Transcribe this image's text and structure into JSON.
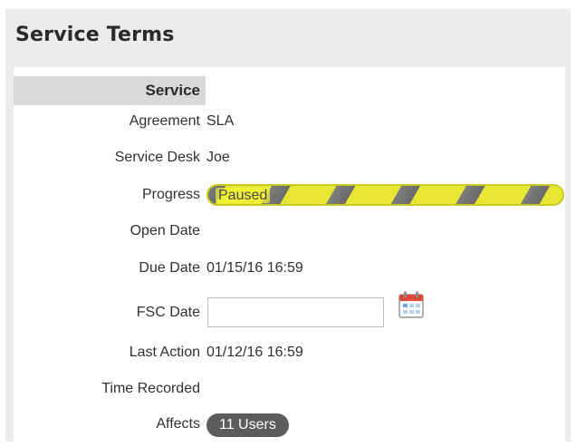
{
  "panel": {
    "title": "Service Terms"
  },
  "section": {
    "header": "Service"
  },
  "fields": {
    "agreement": {
      "label": "Agreement",
      "value": "SLA"
    },
    "service_desk": {
      "label": "Service Desk",
      "value": "Joe"
    },
    "progress": {
      "label": "Progress",
      "status_text": "Paused",
      "fill_fraction": 1.0
    },
    "open_date": {
      "label": "Open Date",
      "value": ""
    },
    "due_date": {
      "label": "Due Date",
      "value": "01/15/16 16:59"
    },
    "fsc_date": {
      "label": "FSC Date",
      "value": "",
      "placeholder": ""
    },
    "last_action": {
      "label": "Last Action",
      "value": "01/12/16 16:59"
    },
    "time_recorded": {
      "label": "Time Recorded",
      "value": ""
    },
    "affects": {
      "label": "Affects",
      "value": "11 Users"
    }
  },
  "icons": {
    "calendar": "calendar-icon"
  },
  "colors": {
    "panel_bg": "#ececec",
    "section_header_bg": "#d9d9d9",
    "progress_yellow": "#f3f336",
    "progress_stripe": "#6a6a6a",
    "pill_bg": "#5c5c5c",
    "calendar_red": "#e04a3a"
  }
}
